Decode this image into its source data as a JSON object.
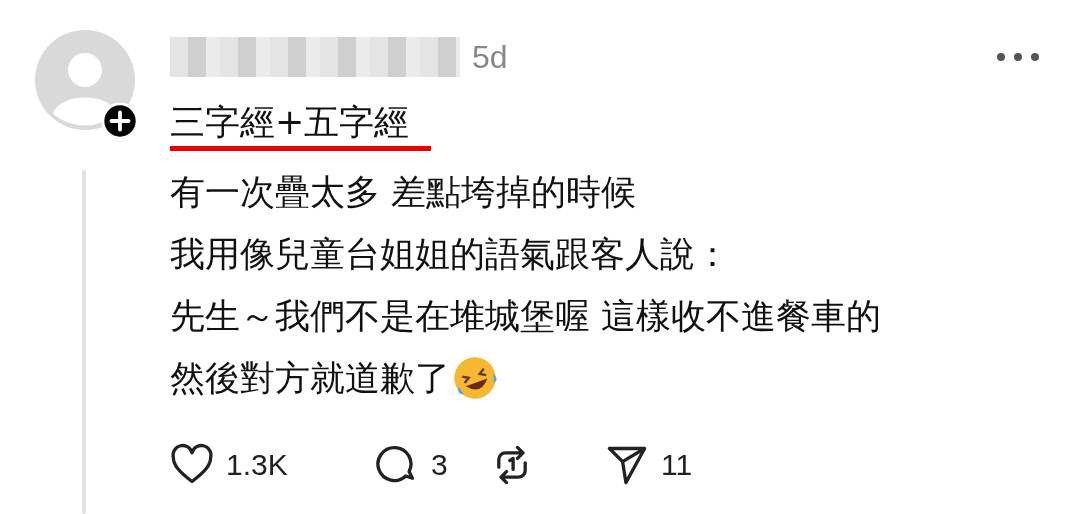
{
  "post": {
    "time": "5d",
    "title": {
      "text": "三字經+五字經",
      "underlined": true
    },
    "lines": [
      "有一次疊太多 差點垮掉的時候",
      "我用像兒童台姐姐的語氣跟客人說：",
      "先生～我們不是在堆城堡喔 這樣收不進餐車的",
      "然後對方就道歉了"
    ],
    "actions": [
      {
        "kind": "like",
        "count": "1.3K"
      },
      {
        "kind": "reply",
        "count": "3"
      },
      {
        "kind": "repost"
      },
      {
        "kind": "share",
        "count": "11"
      }
    ]
  }
}
